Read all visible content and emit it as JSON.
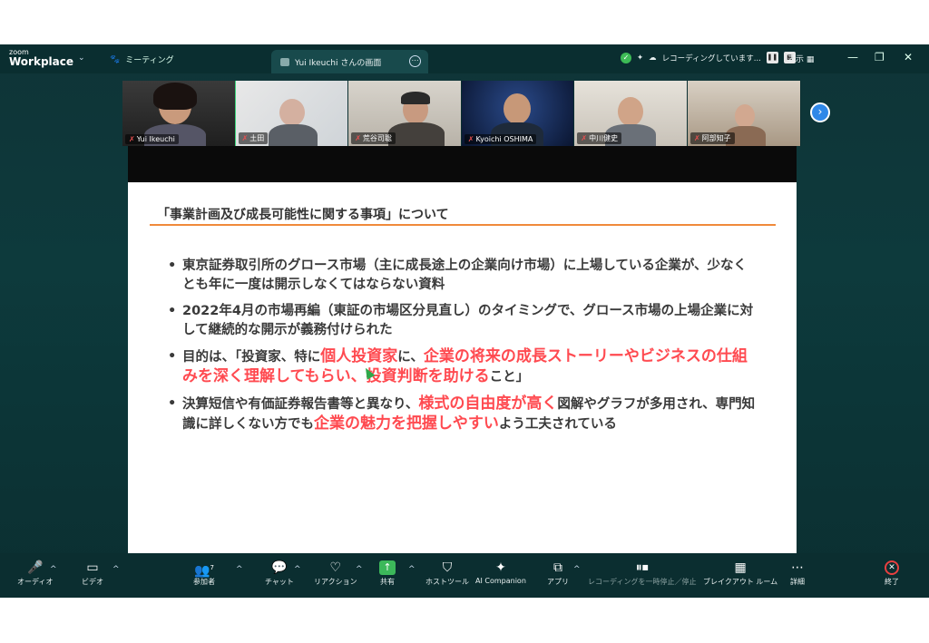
{
  "app": {
    "logo_line1": "zoom",
    "logo_line2": "Workplace",
    "meeting_label": "ミーティング",
    "tab_title": "Yui Ikeuchi さんの画面",
    "recording_status": "レコーディングしています...",
    "view_label": "表示"
  },
  "participants": [
    {
      "name": "Yui Ikeuchi",
      "active": true
    },
    {
      "name": "土田"
    },
    {
      "name": "荒谷司聡"
    },
    {
      "name": "Kyoichi OSHIMA"
    },
    {
      "name": "中川健史"
    },
    {
      "name": "阿部知子"
    }
  ],
  "slide": {
    "title": "「事業計画及び成長可能性に関する事項」について",
    "bullets": [
      {
        "parts": [
          {
            "t": "東京証券取引所のグロース市場（主に成長途上の企業向け市場）に上場している企業が、少なくとも年に一度は開示しなくてはならない資料"
          }
        ]
      },
      {
        "parts": [
          {
            "t": "2022年4月の市場再編（東証の市場区分見直し）のタイミングで、グロース市場の上場企業に対して継続的な開示が義務付けられた"
          }
        ]
      },
      {
        "parts": [
          {
            "t": "目的は、「投資家、特に"
          },
          {
            "t": "個人投資家",
            "red": true
          },
          {
            "t": "に、"
          },
          {
            "t": "企業の将来の成長ストーリーやビジネスの仕組みを深く理解してもらい、投資判断を助ける",
            "red": true
          },
          {
            "t": "こと」"
          }
        ]
      },
      {
        "parts": [
          {
            "t": "決算短信や有価証券報告書等と異なり、"
          },
          {
            "t": "様式の自由度が高く",
            "red": true
          },
          {
            "t": "図解やグラフが多用され、専門知識に詳しくない方でも"
          },
          {
            "t": "企業の魅力を把握しやすい",
            "red": true
          },
          {
            "t": "よう工夫されている"
          }
        ]
      }
    ]
  },
  "toolbar": {
    "audio": "オーディオ",
    "video": "ビデオ",
    "participants": "参加者",
    "participants_count": "7",
    "chat": "チャット",
    "reactions": "リアクション",
    "share": "共有",
    "host_tools": "ホストツール",
    "ai_companion": "AI Companion",
    "apps": "アプリ",
    "recording": "レコーディングを一時停止／停止",
    "breakout": "ブレイクアウト ルーム",
    "more": "詳細",
    "end": "終了"
  }
}
